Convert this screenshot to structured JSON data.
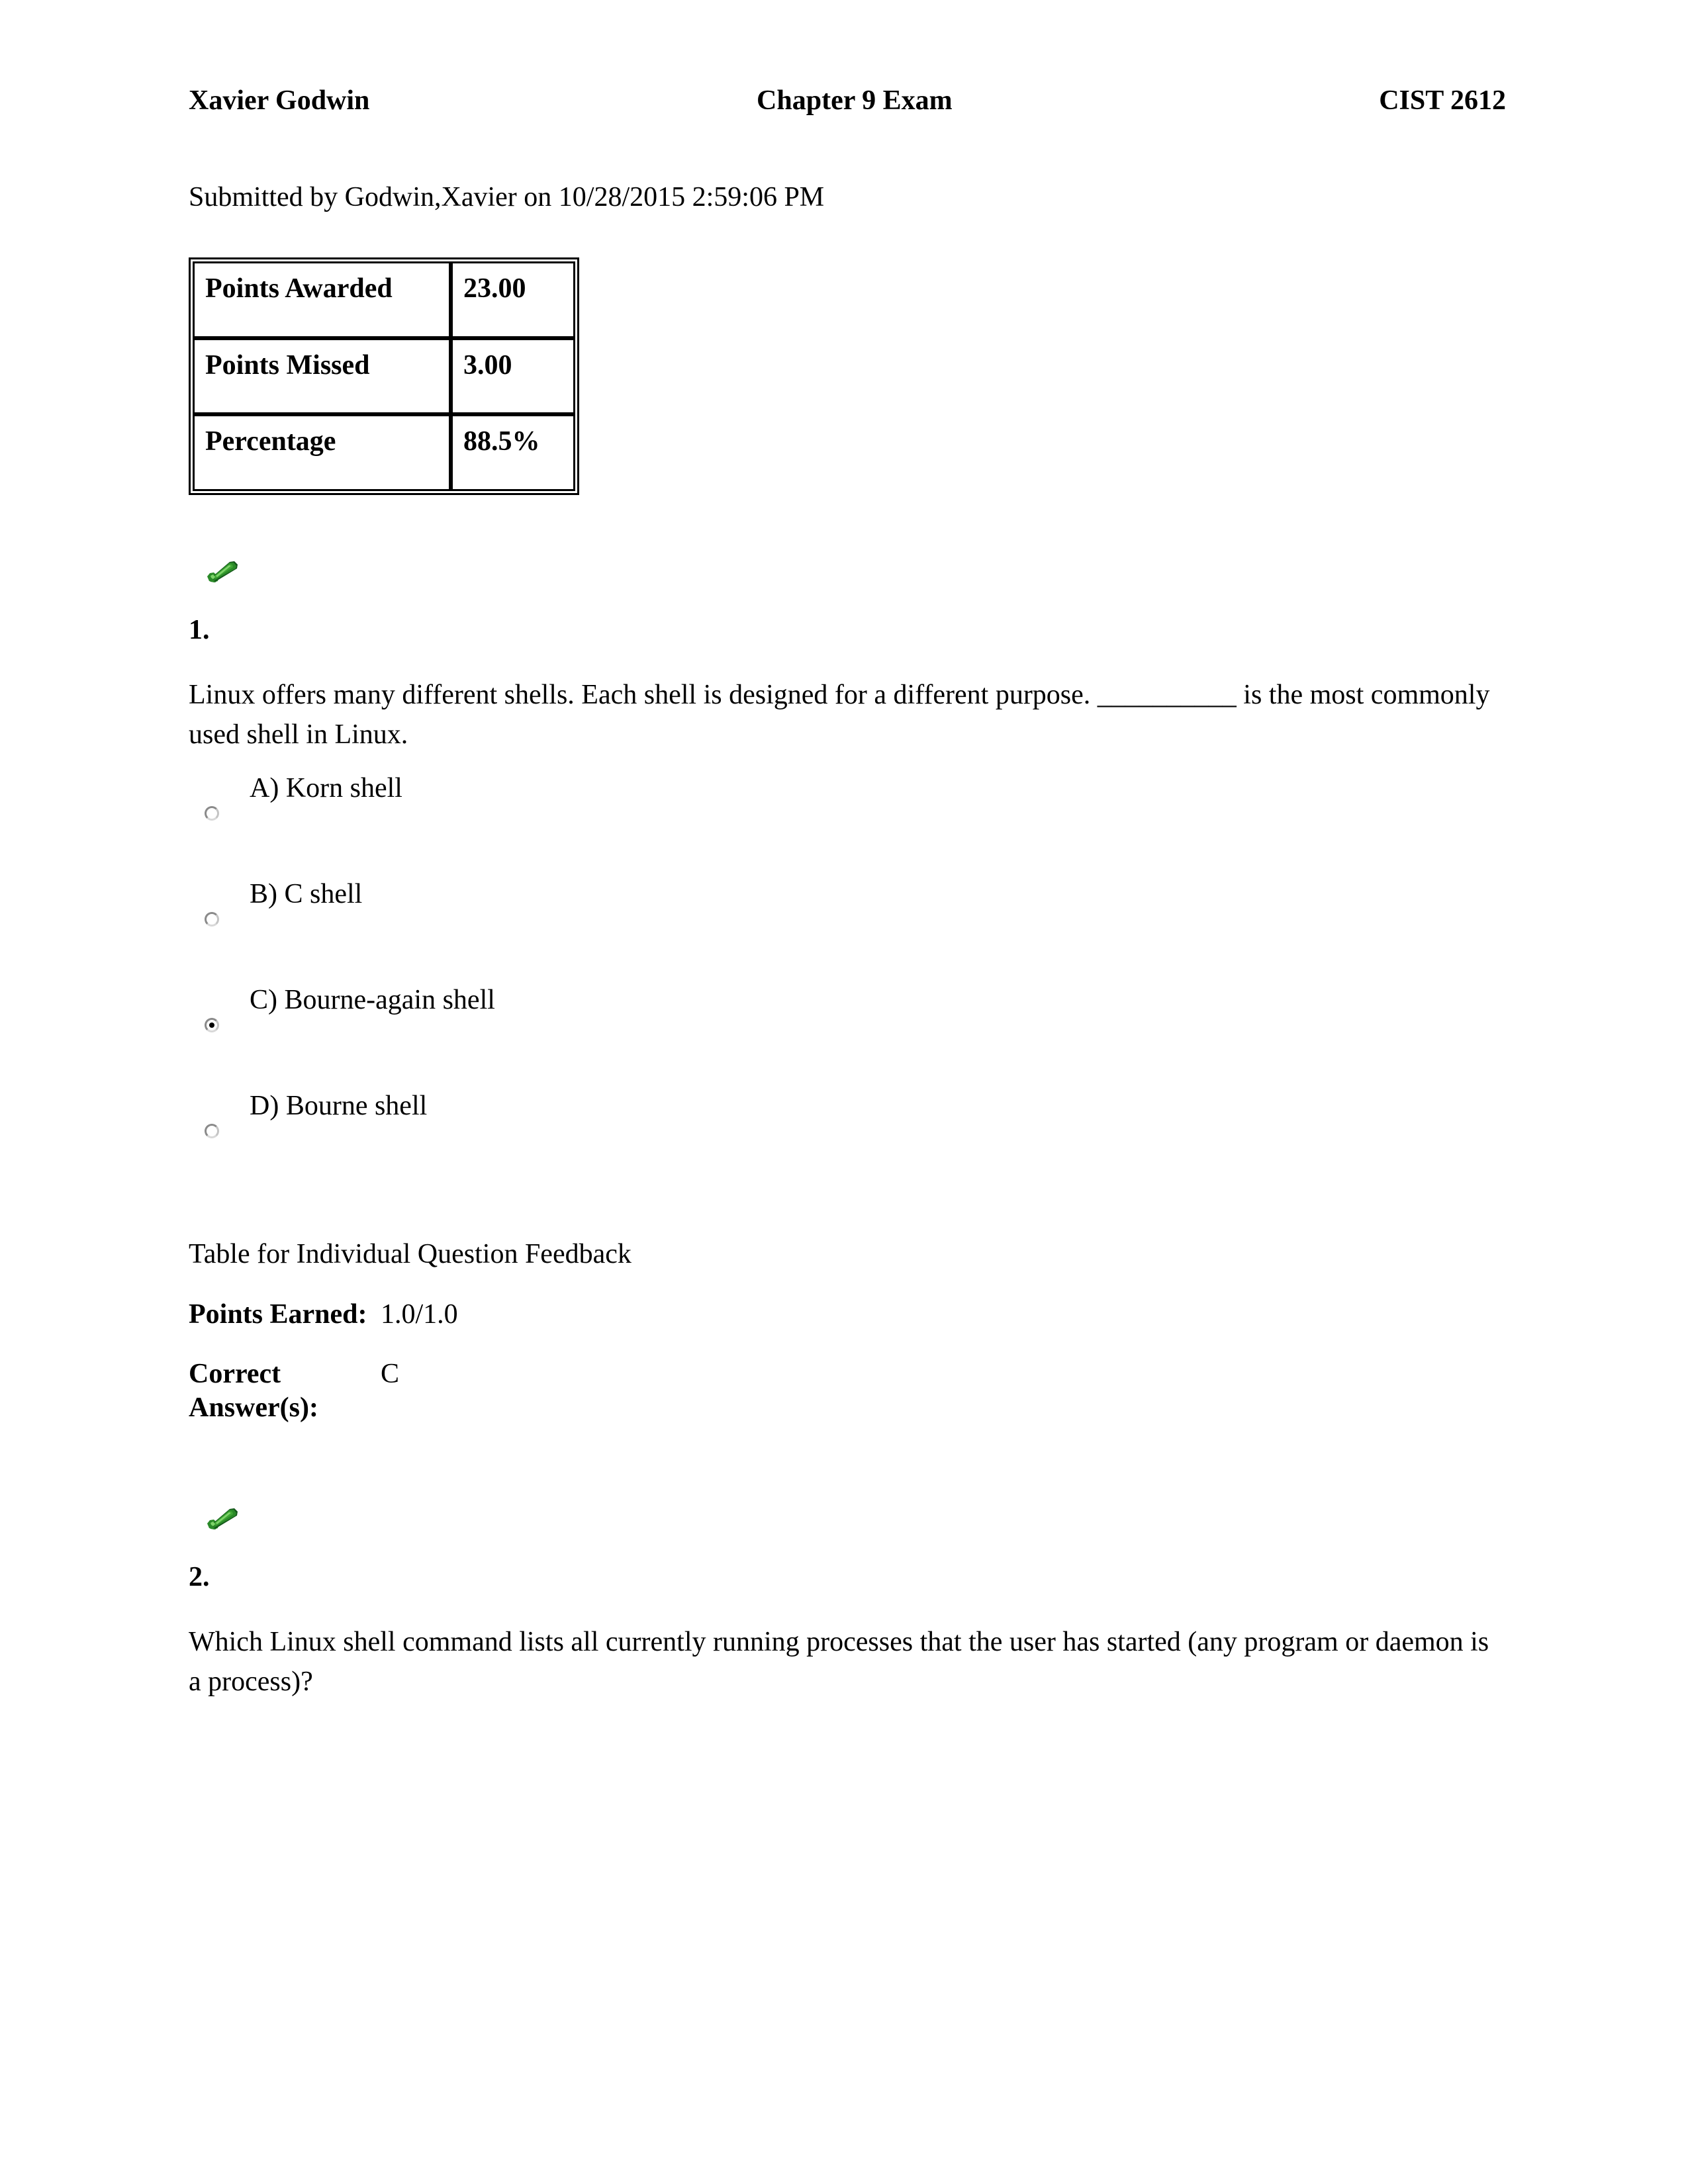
{
  "header": {
    "student_name": "Xavier Godwin",
    "exam_title": "Chapter 9 Exam",
    "course_code": "CIST 2612"
  },
  "submission": {
    "line": "Submitted by Godwin,Xavier on 10/28/2015 2:59:06 PM"
  },
  "score_table": {
    "rows": [
      {
        "label": "Points Awarded",
        "value": "23.00"
      },
      {
        "label": "Points Missed",
        "value": "3.00"
      },
      {
        "label": "Percentage",
        "value": "88.5%"
      }
    ]
  },
  "icons": {
    "correct_check": "green-check-icon"
  },
  "questions": [
    {
      "number": "1.",
      "status_icon": "green-check-icon",
      "text": "Linux offers many different shells. Each shell is designed for a different purpose. __________ is the most commonly used shell in Linux.",
      "options": [
        {
          "label": "A) Korn shell",
          "selected": false
        },
        {
          "label": "B) C shell",
          "selected": false
        },
        {
          "label": "C) Bourne-again shell",
          "selected": true
        },
        {
          "label": "D) Bourne shell",
          "selected": false
        }
      ],
      "feedback_title": "Table for Individual Question Feedback",
      "feedback": [
        {
          "key": "Points Earned:",
          "value": "1.0/1.0"
        },
        {
          "key": "Correct Answer(s):",
          "value": "C"
        }
      ]
    },
    {
      "number": "2.",
      "status_icon": "green-check-icon",
      "text": "Which Linux shell command lists all currently running processes that the user has started (any program or daemon is a process)?"
    }
  ],
  "colors": {
    "check_green_light": "#5cc24a",
    "check_green_mid": "#2a8a28",
    "check_green_dark": "#14561a",
    "text": "#000000",
    "radio_border": "#8a8a8a"
  }
}
